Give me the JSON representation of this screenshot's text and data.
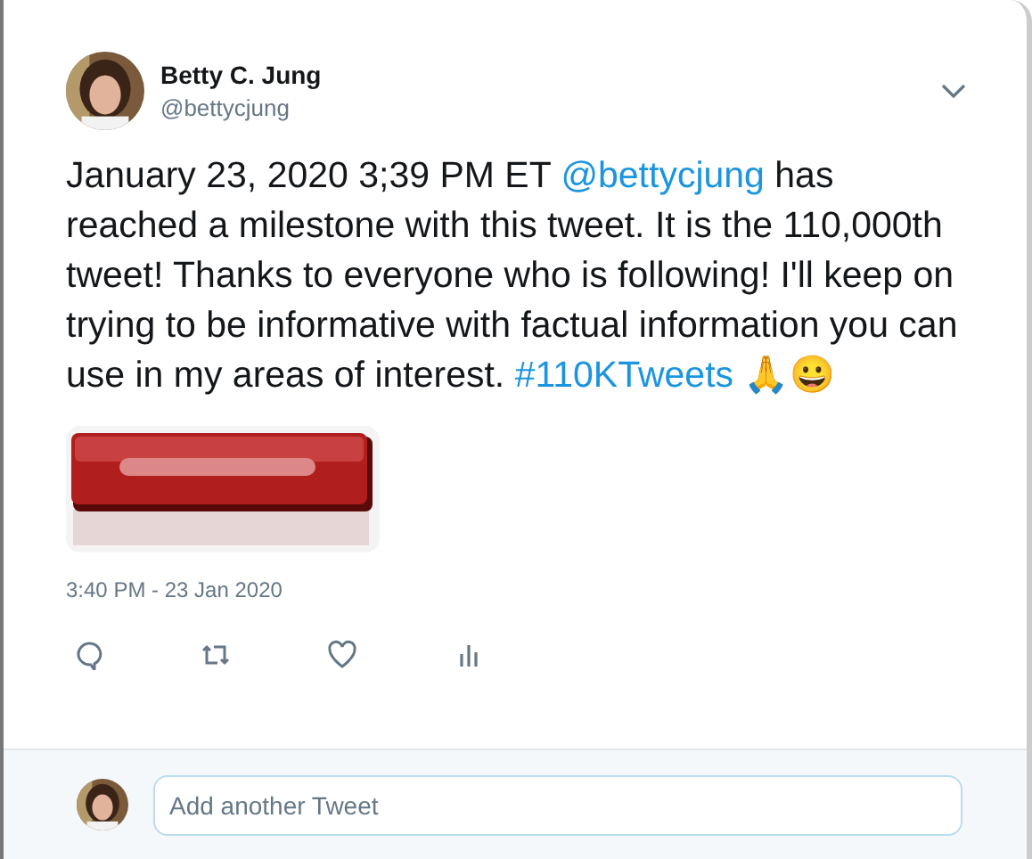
{
  "author": {
    "name": "Betty C. Jung",
    "handle": "@bettycjung"
  },
  "body": [
    {
      "kind": "text",
      "text": "January 23, 2020 3;39 PM ET "
    },
    {
      "kind": "link",
      "text": "@bettycjung"
    },
    {
      "kind": "text",
      "text": " has reached a milestone with this tweet. It is the 110,000th tweet! Thanks to everyone who is following! I'll keep on trying to be informative with factual information you can use in my areas of interest.  "
    },
    {
      "kind": "link",
      "text": "#110KTweets"
    },
    {
      "kind": "text",
      "text": " 🙏😀"
    }
  ],
  "timestamp": "3:40 PM - 23 Jan 2020",
  "actions": [
    {
      "kind": "reply"
    },
    {
      "kind": "retweet"
    },
    {
      "kind": "like"
    },
    {
      "kind": "analytics"
    }
  ],
  "reply_box": {
    "placeholder": "Add another Tweet"
  }
}
